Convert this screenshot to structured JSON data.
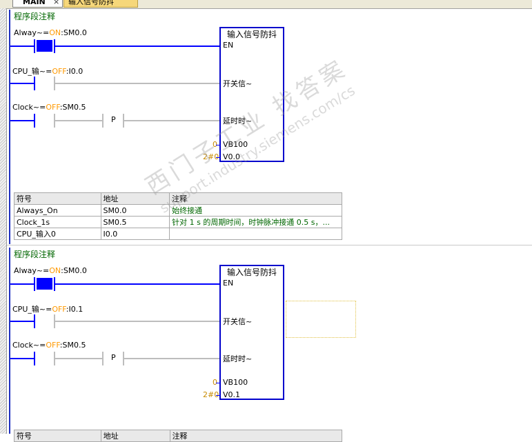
{
  "tabs": {
    "main": "MAIN",
    "main_close": "×",
    "signal": "输入信号防抖"
  },
  "networks": [
    {
      "comment": "程序段注释",
      "contacts": [
        {
          "symbol": "Alway",
          "eq": "~=",
          "state": "ON",
          "addr": ":SM0.0"
        },
        {
          "symbol": "CPU_输",
          "eq": "~=",
          "state": "OFF",
          "addr": ":I0.0"
        },
        {
          "symbol": "Clock",
          "eq": "~=",
          "state": "OFF",
          "addr": ":SM0.5"
        }
      ],
      "p_label": "P",
      "block": {
        "title": "输入信号防抖",
        "pins": [
          "EN",
          "开关信~",
          "延时时~",
          "VB100",
          "V0.0"
        ],
        "pin_values": [
          "0",
          "2#0"
        ]
      },
      "table": {
        "headers": [
          "符号",
          "地址",
          "注释"
        ],
        "rows": [
          [
            "Always_On",
            "SM0.0",
            "始终接通"
          ],
          [
            "Clock_1s",
            "SM0.5",
            "针对 1 s 的周期时间，时钟脉冲接通 0.5 s，..."
          ],
          [
            "CPU_输入0",
            "I0.0",
            ""
          ]
        ]
      }
    },
    {
      "comment": "程序段注释",
      "contacts": [
        {
          "symbol": "Alway",
          "eq": "~=",
          "state": "ON",
          "addr": ":SM0.0"
        },
        {
          "symbol": "CPU_输",
          "eq": "~=",
          "state": "OFF",
          "addr": ":I0.1"
        },
        {
          "symbol": "Clock",
          "eq": "~=",
          "state": "OFF",
          "addr": ":SM0.5"
        }
      ],
      "p_label": "P",
      "block": {
        "title": "输入信号防抖",
        "pins": [
          "EN",
          "开关信~",
          "延时时~",
          "VB100",
          "V0.1"
        ],
        "pin_values": [
          "0",
          "2#0"
        ]
      },
      "table": {
        "headers": [
          "符号",
          "地址",
          "注释"
        ]
      }
    }
  ],
  "watermark": {
    "line1": "西门子工业   找答案",
    "line2": "support.industry.siemens.com/cs"
  },
  "colors": {
    "energized": "#0000ff",
    "deenergized": "#bdbdbd",
    "comment": "#006600",
    "state": "#ff9900"
  }
}
